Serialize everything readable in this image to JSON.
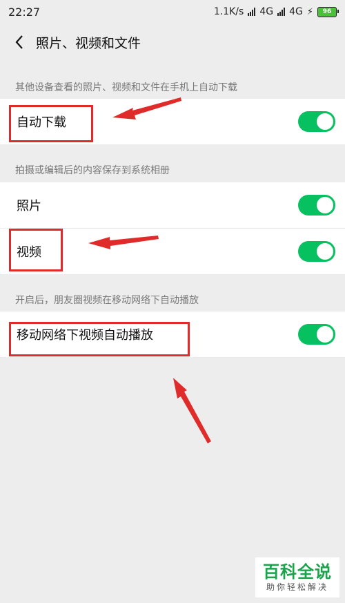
{
  "status": {
    "time": "22:27",
    "speed": "1.1K/s",
    "net1": "4G",
    "net2": "4G",
    "battery": "96"
  },
  "nav": {
    "title": "照片、视频和文件"
  },
  "sections": [
    {
      "header": "其他设备查看的照片、视频和文件在手机上自动下载",
      "rows": [
        {
          "label": "自动下载",
          "enabled": true
        }
      ]
    },
    {
      "header": "拍摄或编辑后的内容保存到系统相册",
      "rows": [
        {
          "label": "照片",
          "enabled": true
        },
        {
          "label": "视频",
          "enabled": true
        }
      ]
    },
    {
      "header": "开启后，朋友圈视频在移动网络下自动播放",
      "rows": [
        {
          "label": "移动网络下视频自动播放",
          "enabled": true
        }
      ]
    }
  ],
  "watermark": {
    "title": "百科全说",
    "subtitle": "助你轻松解决"
  },
  "colors": {
    "toggle_on": "#07c160",
    "annotation": "#e02b2b",
    "background": "#ededed"
  }
}
